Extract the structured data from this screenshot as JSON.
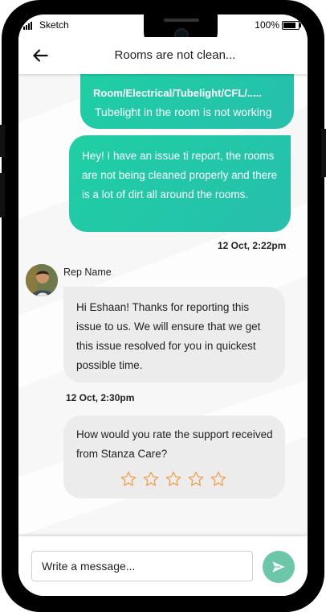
{
  "status": {
    "carrier": "Sketch",
    "battery": "100%"
  },
  "header": {
    "title": "Rooms are not clean..."
  },
  "messages": {
    "first": {
      "category": "Room/Electrical/Tubelight/CFL/.....",
      "text": "Tubelight in the room is not working"
    },
    "second": {
      "text": "Hey! I have an issue ti report, the rooms are not being cleaned properly and there is a lot of dirt all around the rooms.",
      "time": "12 Oct, 2:22pm"
    },
    "rep": {
      "name": "Rep Name",
      "text": "Hi Eshaan! Thanks for reporting this issue to us. We will ensure that we get this issue resolved for you in quickest possible time.",
      "time": "12 Oct, 2:30pm"
    },
    "rating": {
      "text": "How would you rate the support received from Stanza Care?",
      "max": 5,
      "value": 0
    }
  },
  "composer": {
    "placeholder": "Write a message..."
  },
  "colors": {
    "accent": "#22c9a9",
    "send": "#6cc7a8",
    "star": "#f0a04b"
  }
}
